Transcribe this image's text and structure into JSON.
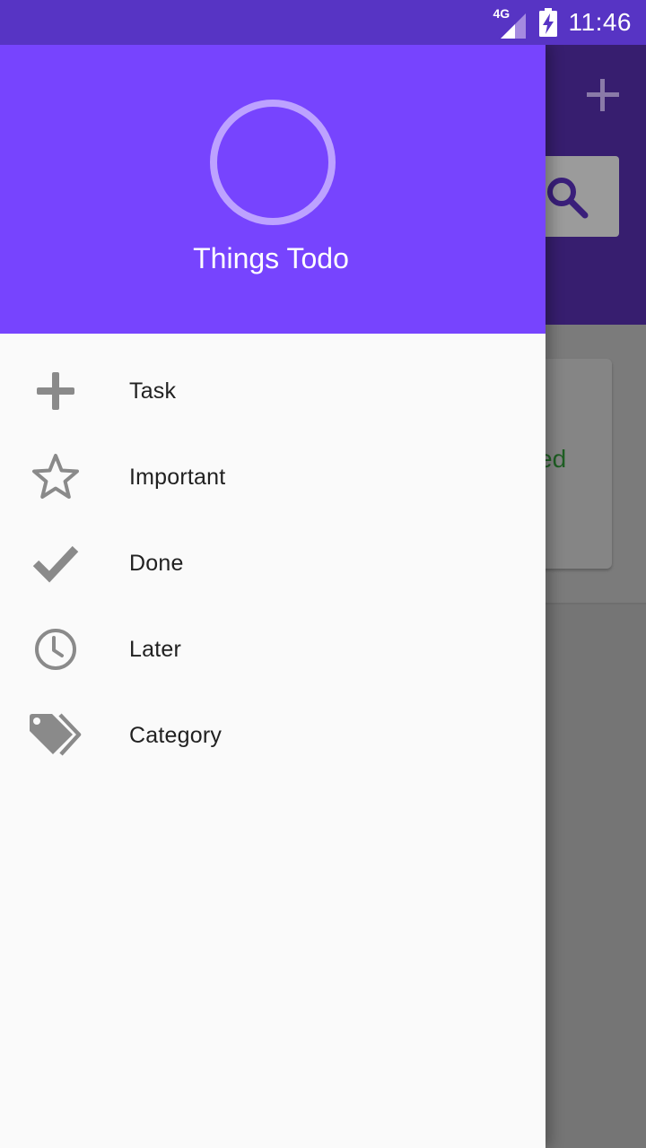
{
  "status_bar": {
    "network": "4G",
    "time": "11:46"
  },
  "drawer": {
    "title": "Things Todo",
    "items": [
      {
        "label": "Task",
        "icon": "plus-icon"
      },
      {
        "label": "Important",
        "icon": "star-icon"
      },
      {
        "label": "Done",
        "icon": "check-icon"
      },
      {
        "label": "Later",
        "icon": "clock-icon"
      },
      {
        "label": "Category",
        "icon": "tags-icon"
      }
    ]
  },
  "background": {
    "card_partial_text": "ed"
  },
  "colors": {
    "primary": "#7744fe",
    "status_bar": "#5734c4",
    "icon_gray": "#8a8a8a",
    "avatar_ring": "#bda2ff"
  }
}
